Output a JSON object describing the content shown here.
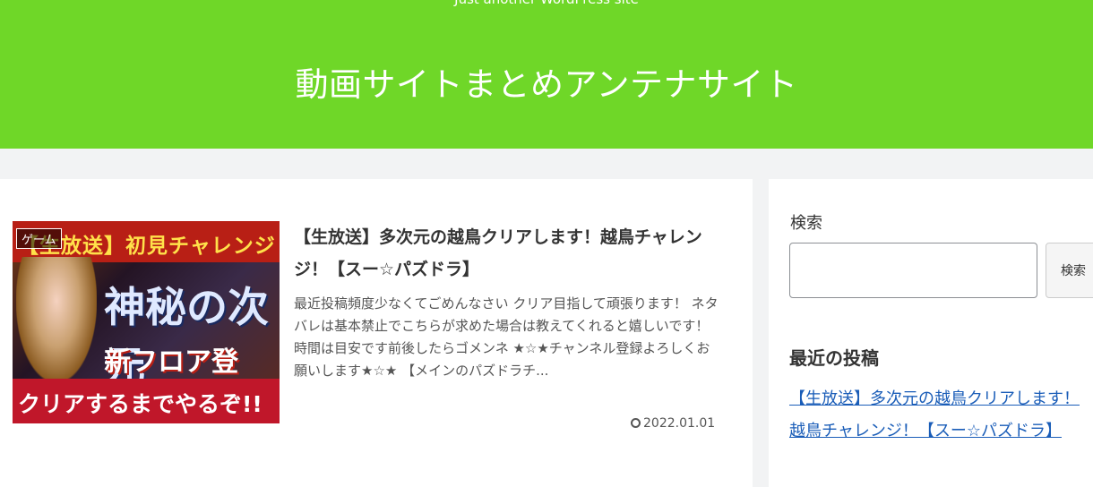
{
  "header": {
    "tagline": "Just another WordPress site",
    "site_title": "動画サイトまとめアンテナサイト"
  },
  "post": {
    "category": "ゲーム",
    "title": "【生放送】多次元の越鳥クリアします！越鳥チャレンジ！【スー☆パズドラ】",
    "excerpt": "最近投稿頻度少なくてごめんなさい クリア目指して頑張ります！ ネタバレは基本禁止でこちらが求めた場合は教えてくれると嬉しいです！ 時間は目安です前後したらゴメンネ ★☆★チャンネル登録よろしくお願いします★☆★ 【メインのパズドラチ...",
    "date": "2022.01.01",
    "thumbnail_text": {
      "line1": "【生放送】初見チャレンジ",
      "line2": "神秘の次元",
      "line3": "新フロア登場！",
      "line4": "クリアするまでやるぞ!!"
    }
  },
  "sidebar": {
    "search_label": "検索",
    "search_value": "",
    "search_button": "検索",
    "recent_heading": "最近の投稿",
    "recent_posts": [
      "【生放送】多次元の越鳥クリアします！越鳥チャレンジ！【スー☆パズドラ】"
    ]
  },
  "colors": {
    "header_bg": "#6fd728",
    "link": "#1a5db8"
  }
}
